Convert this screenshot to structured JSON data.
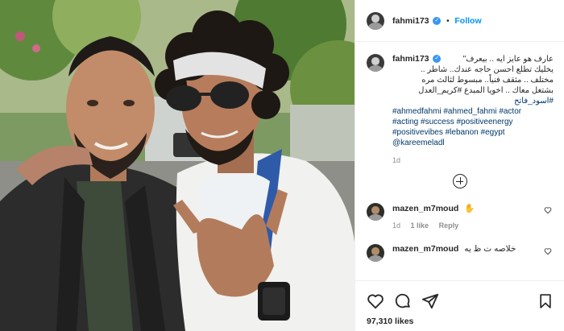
{
  "post": {
    "username": "fahmi173",
    "follow_label": "Follow",
    "dot": "•"
  },
  "caption": {
    "username": "fahmi173",
    "lines": [
      "عارف هو عايز ايه .. بيعرف\"",
      "يخليك تطلع احسن حاجه عندك.. شاطر ..",
      "مختلف .. مثقف فنياً.. مبسوط لثالث مره",
      "بشتغل معاك .. اخويا المبدع #كريم_العدل",
      "#اسود_فاتح"
    ],
    "hashtag_lines": [
      [
        "#ahmedfahmi",
        "#ahmed_fahmi",
        "#actor"
      ],
      [
        "#acting",
        "#success",
        "#positiveenergy"
      ],
      [
        "#positivevibes",
        "#lebanon",
        "#egypt"
      ],
      [
        "@kareemeladl"
      ]
    ],
    "time": "1d"
  },
  "comments": [
    {
      "username": "mazen_m7moud",
      "text": "✋",
      "time": "1d",
      "likes": "1 like",
      "reply": "Reply"
    },
    {
      "username": "mazen_m7moud",
      "text": "خلاصه ت ظ يه",
      "time": "",
      "likes": "",
      "reply": ""
    }
  ],
  "actions": {
    "likes": "97,310 likes",
    "icons": [
      "heart-icon",
      "comment-icon",
      "share-icon",
      "bookmark-icon"
    ]
  },
  "colors": {
    "link": "#00376b",
    "follow": "#0095f6",
    "verified": "#3897f0"
  }
}
